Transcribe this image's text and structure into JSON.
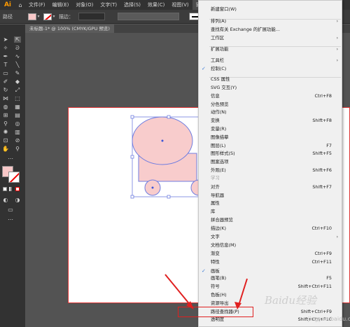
{
  "menubar": {
    "logo": "Ai",
    "items": [
      "文件(F)",
      "编辑(E)",
      "对象(O)",
      "文字(T)",
      "选择(S)",
      "效果(C)",
      "视图(V)",
      "窗口(W)"
    ]
  },
  "controlbar": {
    "label": "路径",
    "stroke_label": "描边："
  },
  "document": {
    "tab": "未标题-1* @ 100% (CMYK/GPU 预览)"
  },
  "window_menu": {
    "items": [
      {
        "label": "新建窗口(W)"
      },
      {
        "label": "排列(A)",
        "submenu": true
      },
      {
        "label": "查找有关 Exchange 的扩展功能..."
      },
      {
        "label": "工作区",
        "submenu": true
      },
      {
        "label": "扩展功能",
        "submenu": true
      },
      {
        "label": "工具栏",
        "submenu": true
      },
      {
        "label": "控制(C)",
        "checked": true
      },
      {
        "label": "CSS 属性"
      },
      {
        "label": "SVG 交互(Y)"
      },
      {
        "label": "信息",
        "shortcut": "Ctrl+F8"
      },
      {
        "label": "分色预览"
      },
      {
        "label": "动作(N)"
      },
      {
        "label": "变换",
        "shortcut": "Shift+F8"
      },
      {
        "label": "变量(R)"
      },
      {
        "label": "图像描摹"
      },
      {
        "label": "图层(L)",
        "shortcut": "F7"
      },
      {
        "label": "图形样式(S)",
        "shortcut": "Shift+F5"
      },
      {
        "label": "图案选项"
      },
      {
        "label": "外观(E)",
        "shortcut": "Shift+F6"
      },
      {
        "label": "学习",
        "disabled": true
      },
      {
        "label": "对齐",
        "shortcut": "Shift+F7"
      },
      {
        "label": "导航器"
      },
      {
        "label": "属性"
      },
      {
        "label": "库"
      },
      {
        "label": "拼合器预览"
      },
      {
        "label": "描边(K)",
        "shortcut": "Ctrl+F10"
      },
      {
        "label": "文字",
        "submenu": true
      },
      {
        "label": "文档信息(M)"
      },
      {
        "label": "渐变",
        "shortcut": "Ctrl+F9"
      },
      {
        "label": "特性",
        "shortcut": "Ctrl+F11"
      },
      {
        "label": "画板",
        "checked": true
      },
      {
        "label": "画笔(B)",
        "shortcut": "F5"
      },
      {
        "label": "符号",
        "shortcut": "Shift+Ctrl+F11"
      },
      {
        "label": "色板(H)"
      },
      {
        "label": "资源导出"
      },
      {
        "label": "路径查找器(P)",
        "shortcut": "Shift+Ctrl+F9"
      },
      {
        "label": "透明度",
        "shortcut": "Shift+Ctrl+F10"
      }
    ]
  },
  "watermark": {
    "brand": "Baidu经验",
    "url": "jingyan.baidu.com"
  },
  "colors": {
    "shape_fill": "#f8cccc",
    "shape_stroke": "#6f7de0",
    "highlight": "#e02020",
    "check": "#3a7bd5"
  }
}
